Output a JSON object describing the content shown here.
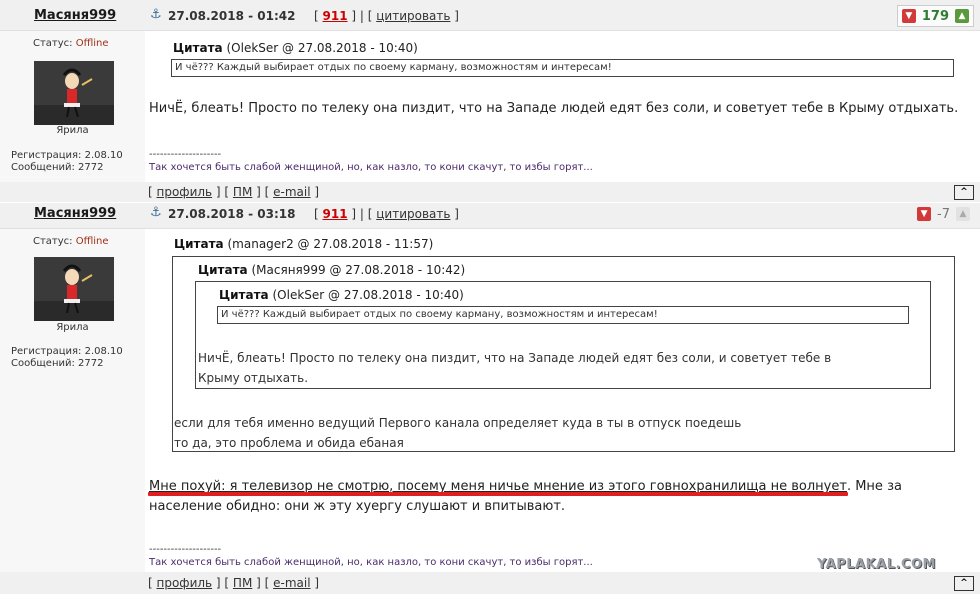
{
  "post1": {
    "author": "Масяня999",
    "date": "27.08.2018 - 01:42",
    "post_num": "911",
    "quote_link": "цитировать",
    "score": "179",
    "status_label": "Статус:",
    "status_value": "Offline",
    "nick": "Ярила",
    "reg": "Регистрация: 2.08.10",
    "msgs": "Сообщений: 2772",
    "quote_label": "Цитата",
    "quote_meta": "(OlekSer @ 27.08.2018 - 10:40)",
    "quote_text": "И чё??? Каждый выбирает отдых по своему карману, возможностям и интересам!",
    "body": "НичЁ, блеать! Просто по телеку она пиздит, что на Западе людей едят без соли, и советует тебе в Крыму отдыхать.",
    "sig_sep": "--------------------",
    "signature": "Так хочется быть слабой женщиной, но, как назло, то кони скачут, то избы горят...",
    "foot": {
      "profile": "профиль",
      "pm": "ПМ",
      "email": "e-mail"
    }
  },
  "post2": {
    "author": "Масяня999",
    "date": "27.08.2018 - 03:18",
    "post_num": "911",
    "quote_link": "цитировать",
    "score": "-7",
    "status_label": "Статус:",
    "status_value": "Offline",
    "nick": "Ярила",
    "reg": "Регистрация: 2.08.10",
    "msgs": "Сообщений: 2772",
    "quote1_label": "Цитата",
    "quote1_meta": "(manager2 @ 27.08.2018 - 11:57)",
    "quote2_label": "Цитата",
    "quote2_meta": "(Масяня999 @ 27.08.2018 - 10:42)",
    "quote3_label": "Цитата",
    "quote3_meta": "(OlekSer @ 27.08.2018 - 10:40)",
    "quote3_text": "И чё??? Каждый выбирает отдых по своему карману, возможностям и интересам!",
    "quote2_text_1": "НичЁ, блеать! Просто по телеку она пиздит, что на Западе людей едят без соли, и советует тебе в",
    "quote2_text_2": "Крыму отдыхать.",
    "quote1_text_1": "если для тебя именно ведущий Первого канала определяет куда в ты в отпуск поедешь",
    "quote1_text_2": "то да, это проблема и обида ебаная",
    "body_1_underlined": "Мне похуй: я телевизор не смотрю, посему меня ничье мнение из этого говнохранилища не волнует",
    "body_1_rest": ". Мне за",
    "body_2": "население обидно: они ж эту хуергу слушают и впитывают.",
    "sig_sep": "--------------------",
    "signature": "Так хочется быть слабой женщиной, но, как назло, то кони скачут, то избы горят...",
    "foot": {
      "profile": "профиль",
      "pm": "ПМ",
      "email": "e-mail"
    }
  },
  "watermark": "YAPLAKAL.COM",
  "colors": {
    "header_bg": "#f0f0f0",
    "offline": "#a0301a",
    "score_positive": "#2e7d32",
    "vote_down": "#d23a3a",
    "vote_up": "#5a9a3c",
    "highlight": "#e02020"
  }
}
